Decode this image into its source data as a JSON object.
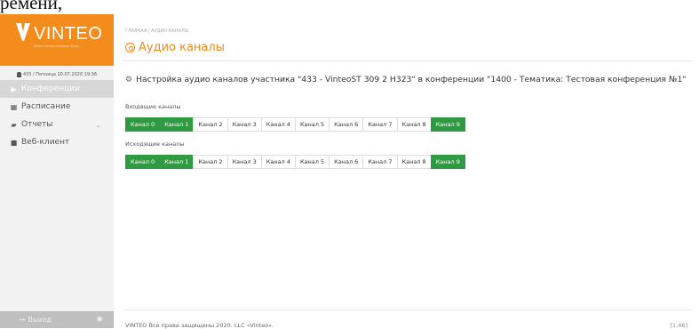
{
  "top_fragment": "ремени,",
  "logo": {
    "text": "VINTEO",
    "subtitle": "Video Communications Expe..."
  },
  "user": {
    "line": "433 / Пятница 10.07.2020 19:36"
  },
  "sidebar": {
    "items": [
      {
        "label": "Конференции",
        "icon": "play-forward-icon",
        "active": true
      },
      {
        "label": "Расписание",
        "icon": "calendar-icon",
        "active": false
      },
      {
        "label": "Отчеты",
        "icon": "book-icon",
        "active": false
      },
      {
        "label": "Веб-клиент",
        "icon": "video-camera-icon",
        "active": false
      }
    ],
    "logout_label": "Выход"
  },
  "breadcrumb": "ГЛАВНАЯ / АУДИО КАНАЛЫ",
  "page_title": "Аудио каналы",
  "heading": "Настройка аудио каналов участника \"433 - VinteoST 309 2 H323\" в конференции \"1400 - Тематика: Тестовая конференция №1\"",
  "incoming": {
    "label": "Входящие каналы",
    "channels": [
      {
        "label": "Канал 0",
        "on": true
      },
      {
        "label": "Канал 1",
        "on": true
      },
      {
        "label": "Канал 2",
        "on": false
      },
      {
        "label": "Канал 3",
        "on": false
      },
      {
        "label": "Канал 4",
        "on": false
      },
      {
        "label": "Канал 5",
        "on": false
      },
      {
        "label": "Канал 6",
        "on": false
      },
      {
        "label": "Канал 7",
        "on": false
      },
      {
        "label": "Канал 8",
        "on": false
      },
      {
        "label": "Канал 9",
        "on": true
      }
    ]
  },
  "outgoing": {
    "label": "Исходящие каналы",
    "channels": [
      {
        "label": "Канал 0",
        "on": true
      },
      {
        "label": "Канал 1",
        "on": true
      },
      {
        "label": "Канал 2",
        "on": false
      },
      {
        "label": "Канал 3",
        "on": false
      },
      {
        "label": "Канал 4",
        "on": false
      },
      {
        "label": "Канал 5",
        "on": false
      },
      {
        "label": "Канал 6",
        "on": false
      },
      {
        "label": "Канал 7",
        "on": false
      },
      {
        "label": "Канал 8",
        "on": false
      },
      {
        "label": "Канал 9",
        "on": true
      }
    ]
  },
  "footer": {
    "text": "VINTEO  Все права защищены 2020. LLC «Vinteo».",
    "version": "[1.46]"
  },
  "colors": {
    "brand_orange": "#f48c1c",
    "channel_on": "#2f9a41"
  }
}
